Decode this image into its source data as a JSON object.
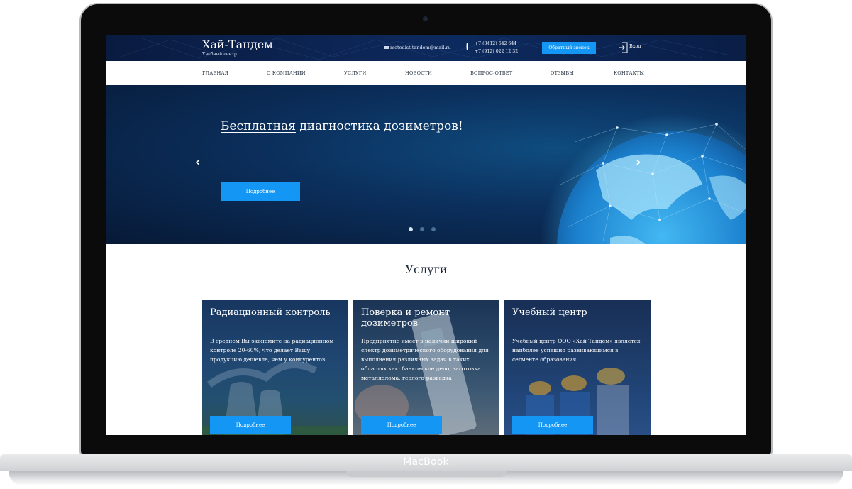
{
  "device": {
    "label": "MacBook"
  },
  "header": {
    "logo_title": "Хай-Тандем",
    "logo_subtitle": "Учебный центр",
    "email": "metodist.tandem@mail.ru",
    "phone_1": "+7 (3412) 642 644",
    "phone_2": "+7 (912) 022 12 32",
    "callback_label": "Обратный звонок",
    "login_label": "Вход"
  },
  "nav": {
    "items": [
      "ГЛАВНАЯ",
      "О КОМПАНИИ",
      "УСЛУГИ",
      "НОВОСТИ",
      "ВОПРОС-ОТВЕТ",
      "ОТЗЫВЫ",
      "КОНТАКТЫ"
    ]
  },
  "hero": {
    "title_highlight": "Бесплатная",
    "title_rest": " диагностика дозиметров!",
    "button_label": "Подробнее",
    "prev_arrow": "‹",
    "next_arrow": "›",
    "slides_count": 3,
    "active_slide": 1
  },
  "services": {
    "title": "Услуги",
    "cards": [
      {
        "title": "Радиационный контроль",
        "text": "В среднем Вы экономите на радиационном контроле 20-60%, что делает Вашу продукцию дешевле, чем у конкурентов.",
        "button_label": "Подробнее"
      },
      {
        "title": "Поверка и ремонт дозиметров",
        "text": "Предприятие имеет в наличии широкий спектр дозиметрического оборудования для выполнения различных задач в таких областях как: банковское дело, заготовка металлолома, геолого-разведка",
        "button_label": "Подробнее"
      },
      {
        "title": "Учебный центр",
        "text": "Учебный центр ООО «Хай-Тандем» является наиболее успешно развивающимся в сегменте образования.",
        "button_label": "Подробнее"
      }
    ]
  },
  "colors": {
    "accent": "#1496f4",
    "header_bg": "#0d2a5e",
    "hero_bg": "#0b2f5c",
    "text_dark": "#1e2a3a"
  }
}
